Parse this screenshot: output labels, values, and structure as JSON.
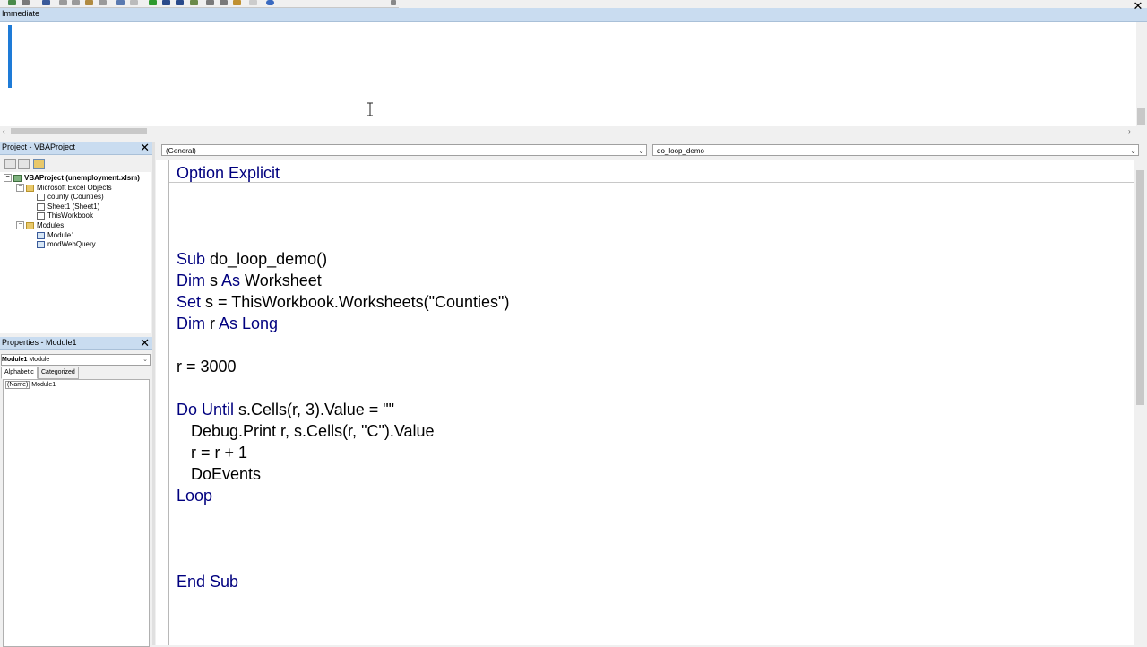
{
  "immediate": {
    "title": "Immediate"
  },
  "project_explorer": {
    "title": "Project - VBAProject",
    "tree": [
      {
        "label": "VBAProject (unemployment.xlsm)",
        "level": 0,
        "icon": "project-icon"
      },
      {
        "label": "Microsoft Excel Objects",
        "level": 1,
        "icon": "folder-icon"
      },
      {
        "label": "county (Counties)",
        "level": 2,
        "icon": "sheet-icon"
      },
      {
        "label": "Sheet1 (Sheet1)",
        "level": 2,
        "icon": "sheet-icon"
      },
      {
        "label": "ThisWorkbook",
        "level": 2,
        "icon": "workbook-icon"
      },
      {
        "label": "Modules",
        "level": 1,
        "icon": "folder-icon"
      },
      {
        "label": "Module1",
        "level": 2,
        "icon": "module-icon"
      },
      {
        "label": "modWebQuery",
        "level": 2,
        "icon": "module-icon"
      }
    ]
  },
  "properties": {
    "title": "Properties - Module1",
    "object_name": "Module1",
    "object_type": "Module",
    "tabs": [
      "Alphabetic",
      "Categorized"
    ],
    "rows": [
      {
        "name": "(Name)",
        "value": "Module1"
      }
    ]
  },
  "code_window": {
    "object_combo": "(General)",
    "procedure_combo": "do_loop_demo",
    "lines": {
      "l1": {
        "kw": "Option Explicit",
        "rest": ""
      },
      "l2": {
        "kw": "Sub",
        "rest": " do_loop_demo()"
      },
      "l3a": {
        "kw": "Dim",
        "rest": " s "
      },
      "l3b": {
        "kw": "As",
        "rest": " Worksheet"
      },
      "l4": {
        "kw": "Set",
        "rest": " s = ThisWorkbook.Worksheets(\"Counties\")"
      },
      "l5a": {
        "kw": "Dim",
        "rest": " r "
      },
      "l5b": {
        "kw": "As Long",
        "rest": ""
      },
      "l6": {
        "kw": "",
        "rest": "r = 3000"
      },
      "l7": {
        "kw": "Do Until",
        "rest": " s.Cells(r, 3).Value = \"\""
      },
      "l8": {
        "kw": "",
        "rest": "Debug.Print r, s.Cells(r, \"C\").Value"
      },
      "l9": {
        "kw": "",
        "rest": "r = r + 1"
      },
      "l10": {
        "kw": "",
        "rest": "DoEvents"
      },
      "l11": {
        "kw": "Loop",
        "rest": ""
      },
      "l12": {
        "kw": "End Sub",
        "rest": ""
      }
    }
  },
  "colors": {
    "keyword": "#00007f",
    "title_bar": "#c9dcf0",
    "caret": "#1e7bd7"
  }
}
